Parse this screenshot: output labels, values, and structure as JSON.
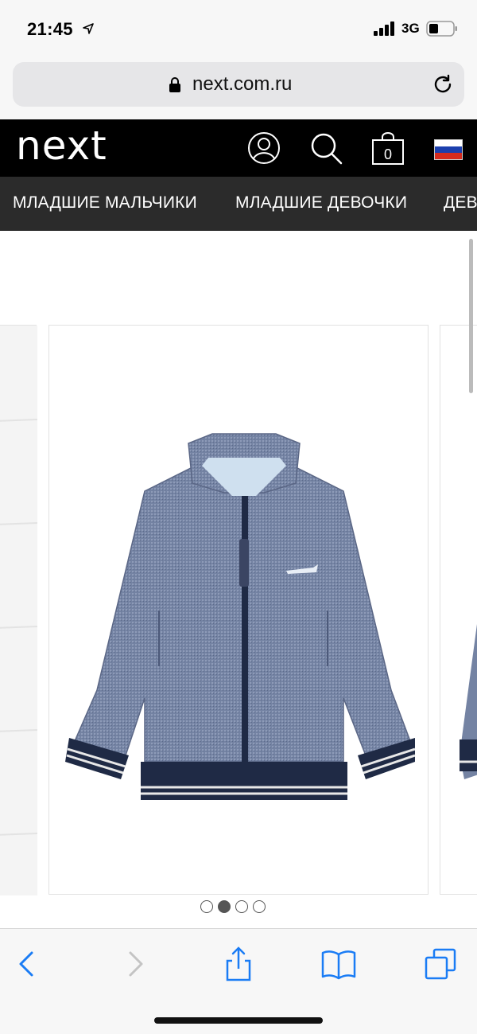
{
  "status_bar": {
    "time": "21:45",
    "network": "3G",
    "icons": [
      "location-arrow-icon",
      "signal-icon",
      "battery-icon"
    ]
  },
  "browser": {
    "url": "next.com.ru",
    "icons": [
      "lock-icon",
      "reload-icon"
    ]
  },
  "header": {
    "logo": "next",
    "bag_count": "0",
    "icons": [
      "account-icon",
      "search-icon",
      "bag-icon",
      "russia-flag-icon"
    ]
  },
  "categories": [
    "МЛАДШИЕ МАЛЬЧИКИ",
    "МЛАДШИЕ ДЕВОЧКИ",
    "ДЕВ"
  ],
  "carousel": {
    "slides": 4,
    "active_index": 1,
    "product_image": "navy-chambray-bomber-jacket"
  },
  "toolbar": {
    "icons": [
      "back-icon",
      "forward-icon",
      "share-icon",
      "bookmarks-icon",
      "tabs-icon"
    ]
  },
  "colors": {
    "header_bg": "#000000",
    "nav_bg": "#2b2b2b",
    "chrome_bg": "#f7f7f7",
    "ios_blue": "#1a7cf5"
  }
}
